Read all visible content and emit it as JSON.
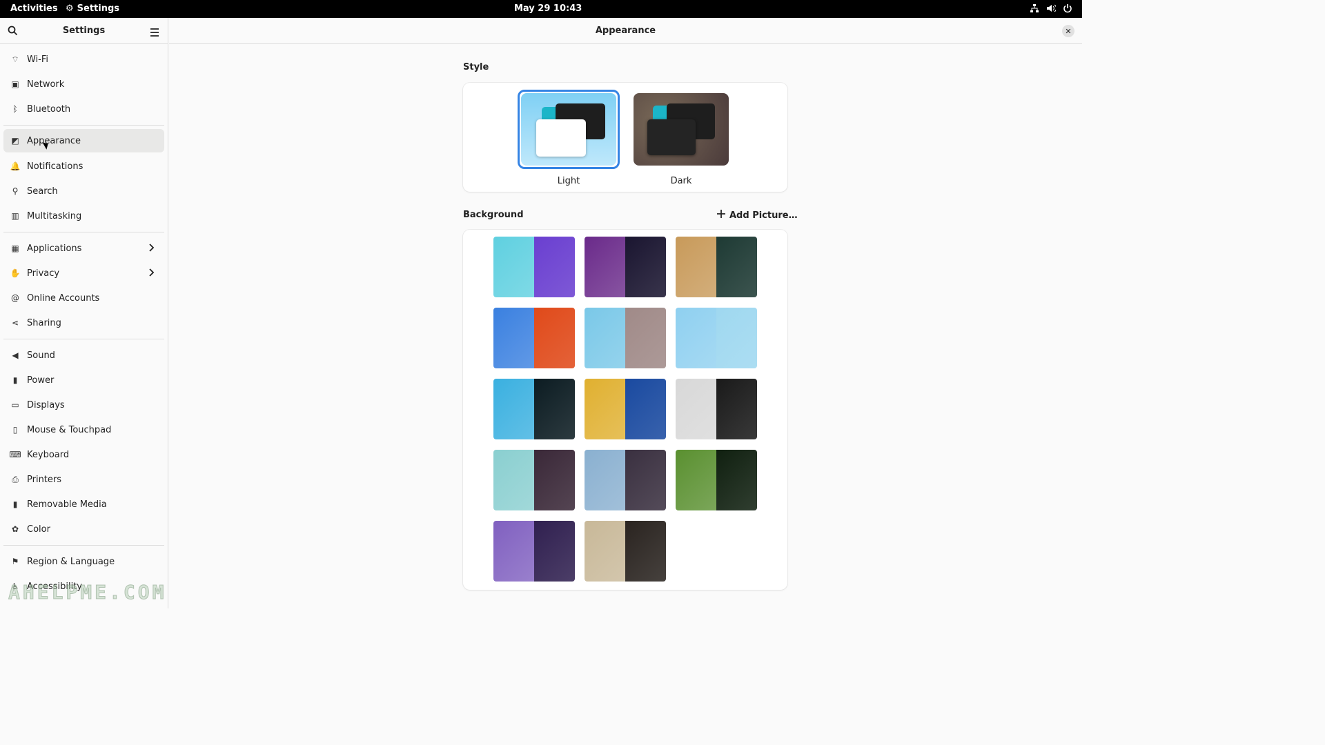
{
  "topbar": {
    "activities": "Activities",
    "app_name": "Settings",
    "clock": "May 29  10:43"
  },
  "sidebar": {
    "title": "Settings",
    "groups": [
      [
        {
          "label": "Wi-Fi",
          "icon": "wifi-icon"
        },
        {
          "label": "Network",
          "icon": "network-icon"
        },
        {
          "label": "Bluetooth",
          "icon": "bluetooth-icon"
        }
      ],
      [
        {
          "label": "Appearance",
          "icon": "appearance-icon",
          "active": true
        },
        {
          "label": "Notifications",
          "icon": "bell-icon"
        },
        {
          "label": "Search",
          "icon": "search-icon"
        },
        {
          "label": "Multitasking",
          "icon": "multitasking-icon"
        }
      ],
      [
        {
          "label": "Applications",
          "icon": "apps-grid-icon",
          "chevron": true
        },
        {
          "label": "Privacy",
          "icon": "hand-icon",
          "chevron": true
        },
        {
          "label": "Online Accounts",
          "icon": "at-icon"
        },
        {
          "label": "Sharing",
          "icon": "share-icon"
        }
      ],
      [
        {
          "label": "Sound",
          "icon": "speaker-icon"
        },
        {
          "label": "Power",
          "icon": "power-icon"
        },
        {
          "label": "Displays",
          "icon": "display-icon"
        },
        {
          "label": "Mouse & Touchpad",
          "icon": "mouse-icon"
        },
        {
          "label": "Keyboard",
          "icon": "keyboard-icon"
        },
        {
          "label": "Printers",
          "icon": "printer-icon"
        },
        {
          "label": "Removable Media",
          "icon": "usb-icon"
        },
        {
          "label": "Color",
          "icon": "color-icon"
        }
      ],
      [
        {
          "label": "Region & Language",
          "icon": "flag-icon"
        },
        {
          "label": "Accessibility",
          "icon": "accessibility-icon"
        }
      ]
    ]
  },
  "main": {
    "title": "Appearance",
    "style_section": "Style",
    "styles": [
      {
        "label": "Light",
        "selected": true
      },
      {
        "label": "Dark",
        "selected": false
      }
    ],
    "background_section": "Background",
    "add_picture": "Add Picture…",
    "backgrounds": [
      {
        "name": "triangles",
        "left": "#5fd0e0",
        "right": "#6a3fd0"
      },
      {
        "name": "waves",
        "left": "#6a2a8a",
        "right": "#1a1530"
      },
      {
        "name": "texture",
        "left": "#c89a5a",
        "right": "#1e3a34"
      },
      {
        "name": "drool",
        "left": "#3a80e0",
        "right": "#e04a1a"
      },
      {
        "name": "adwaita",
        "left": "#7ac8e8",
        "right": "#a08a88"
      },
      {
        "name": "adwaita-light",
        "left": "#8fd0f0",
        "right": "#9fd8f0"
      },
      {
        "name": "blobs",
        "left": "#3ab0e0",
        "right": "#0c1c22"
      },
      {
        "name": "pattern",
        "left": "#e0b030",
        "right": "#1a4aa0"
      },
      {
        "name": "pier",
        "left": "#d8d8d8",
        "right": "#1a1a1a"
      },
      {
        "name": "blossom",
        "left": "#8acfd0",
        "right": "#3a2838"
      },
      {
        "name": "wheat",
        "left": "#8ab0d0",
        "right": "#3a3040"
      },
      {
        "name": "dandelion",
        "left": "#5a9030",
        "right": "#102010"
      },
      {
        "name": "sunset",
        "left": "#8060c0",
        "right": "#302050"
      },
      {
        "name": "zen",
        "left": "#c8b898",
        "right": "#2a2420"
      }
    ]
  },
  "watermark": "AHELPME.COM",
  "colors": {
    "accent": "#3584e4"
  }
}
